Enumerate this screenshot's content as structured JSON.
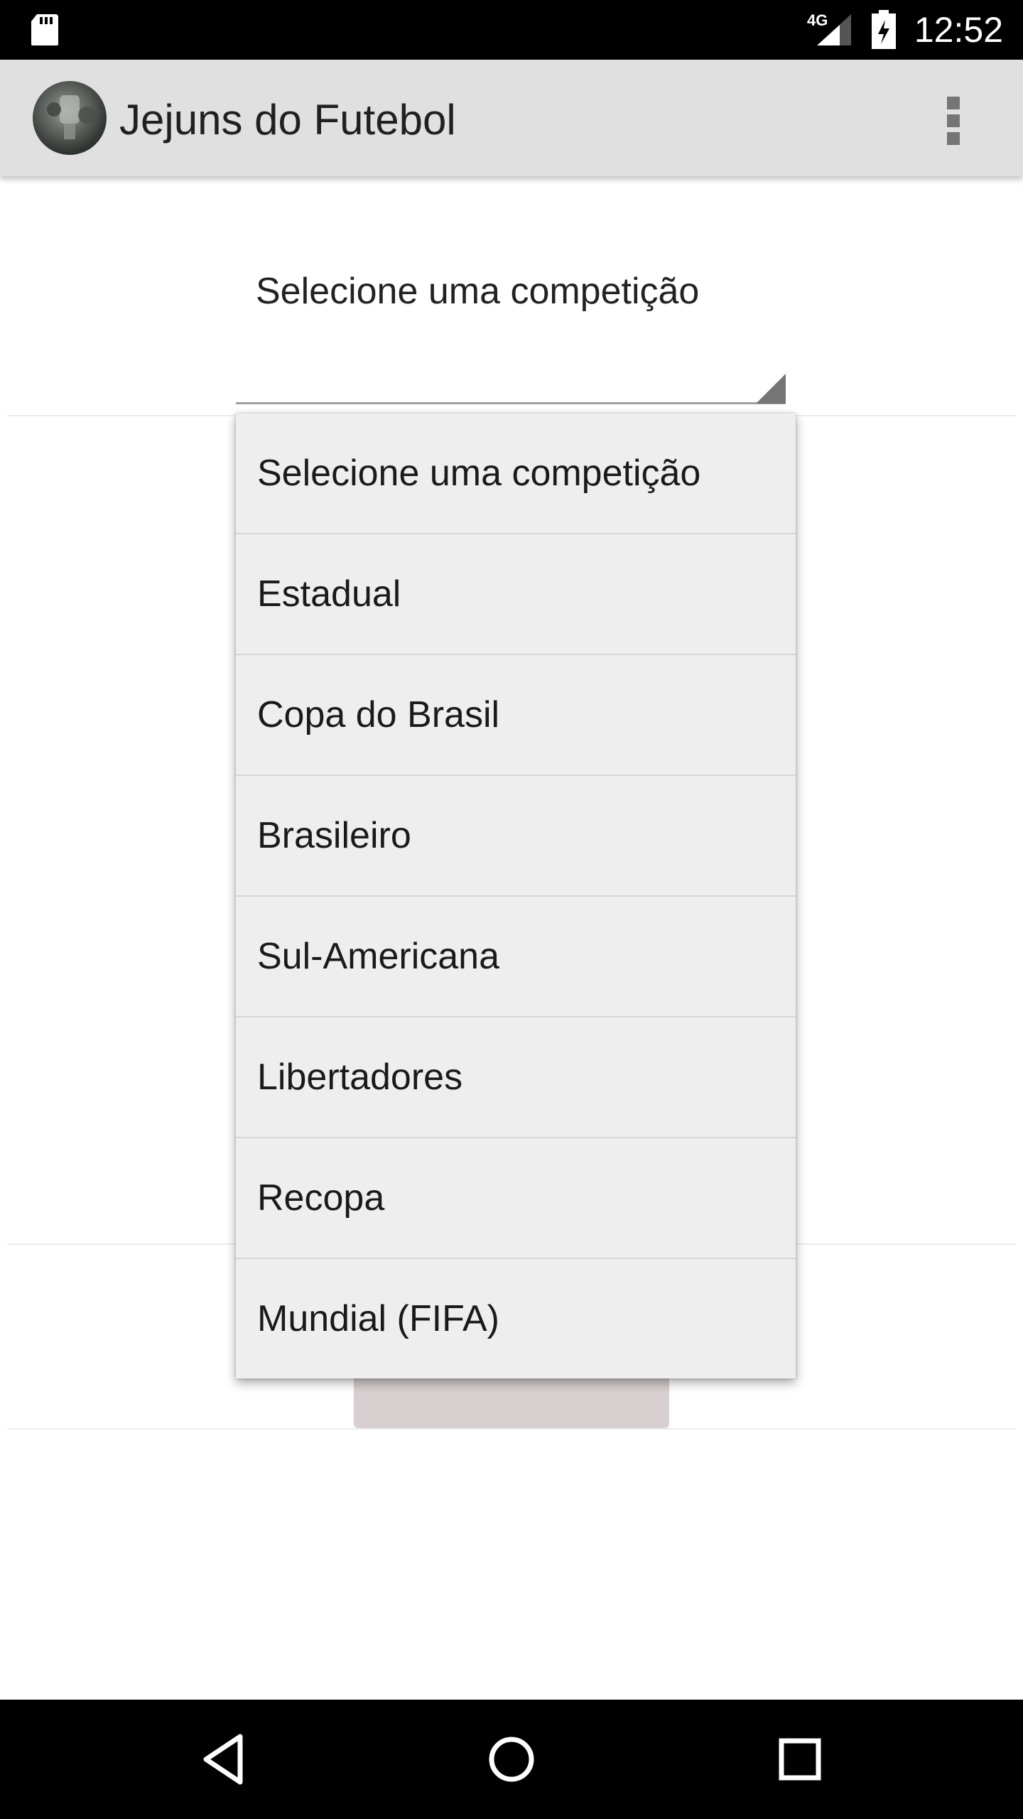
{
  "status_bar": {
    "time": "12:52",
    "network": "4G",
    "icons": [
      "sd-card-icon",
      "signal-icon",
      "battery-charging-icon"
    ]
  },
  "app_bar": {
    "title": "Jejuns do Futebol",
    "logo": "app-logo",
    "menu_icon": "overflow-menu-icon"
  },
  "main": {
    "spinner_label": "Selecione uma competição"
  },
  "dropdown": {
    "items": [
      "Selecione uma competição",
      "Estadual",
      "Copa do Brasil",
      "Brasileiro",
      "Sul-Americana",
      "Libertadores",
      "Recopa",
      "Mundial (FIFA)"
    ]
  },
  "nav_bar": {
    "icons": [
      "back-icon",
      "home-icon",
      "recents-icon"
    ]
  },
  "colors": {
    "status_bar": "#000000",
    "app_bar": "#e0e0e0",
    "dropdown_bg": "#eeeeee",
    "button_bg": "#d7cfd0"
  }
}
